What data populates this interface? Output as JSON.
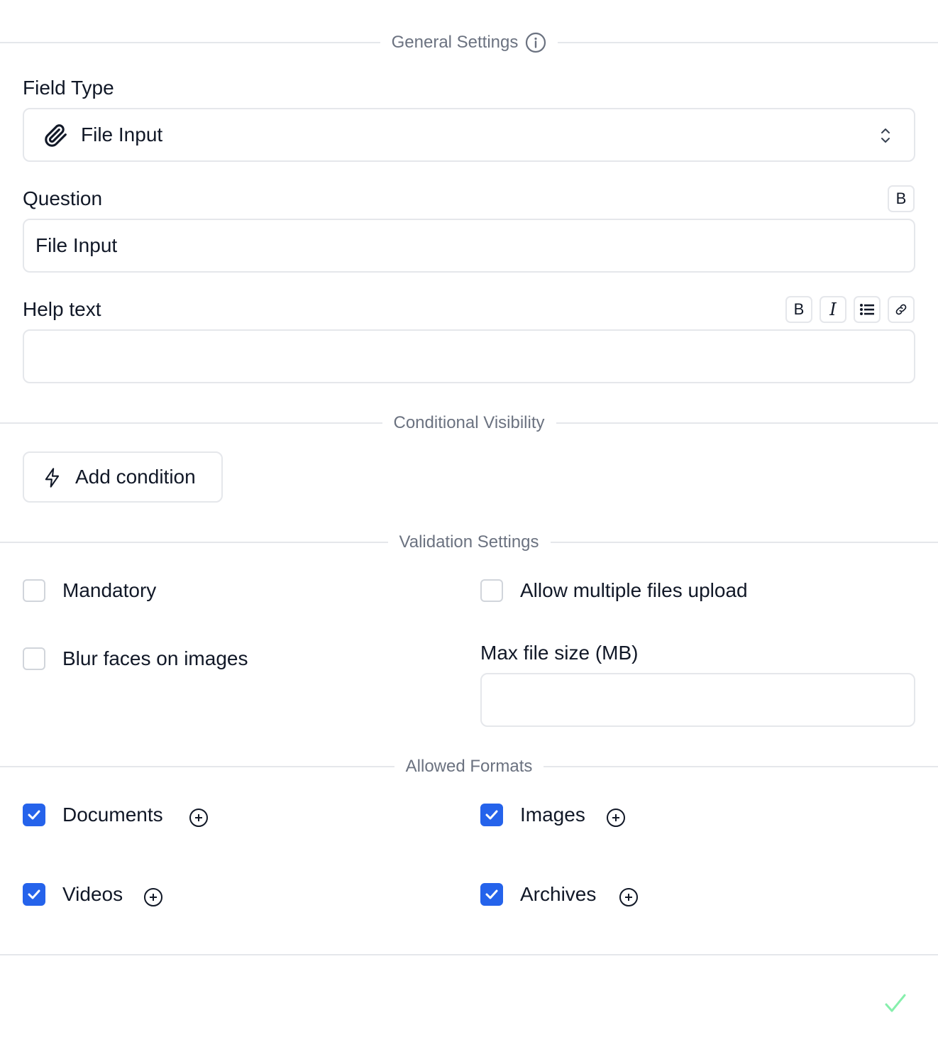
{
  "sections": {
    "general": "General Settings",
    "conditional": "Conditional Visibility",
    "validation": "Validation Settings",
    "formats": "Allowed Formats"
  },
  "field_type": {
    "label": "Field Type",
    "value": "File Input",
    "icon": "paperclip-icon"
  },
  "question": {
    "label": "Question",
    "value": "File Input",
    "toolbar": [
      "B"
    ]
  },
  "help_text": {
    "label": "Help text",
    "value": "",
    "toolbar": [
      "B",
      "I",
      "list",
      "link"
    ]
  },
  "conditional": {
    "add_condition_label": "Add condition"
  },
  "validation": {
    "mandatory": {
      "label": "Mandatory",
      "checked": false
    },
    "blur_faces": {
      "label": "Blur faces on images",
      "checked": false
    },
    "multiple_files": {
      "label": "Allow multiple files upload",
      "checked": false
    },
    "max_file_size": {
      "label": "Max file size (MB)",
      "value": ""
    }
  },
  "formats": [
    {
      "label": "Documents",
      "checked": true
    },
    {
      "label": "Images",
      "checked": true
    },
    {
      "label": "Videos",
      "checked": true
    },
    {
      "label": "Archives",
      "checked": true
    }
  ],
  "colors": {
    "accent": "#2563eb",
    "confirm": "#86efac",
    "border": "#e5e7eb",
    "muted_text": "#6b7280"
  }
}
